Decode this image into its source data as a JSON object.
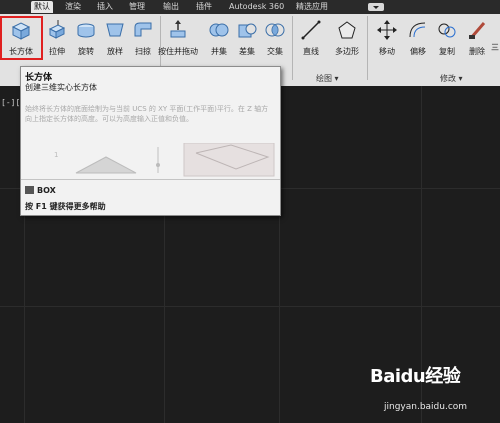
{
  "tabs": [
    {
      "label": "默认",
      "active": true
    },
    {
      "label": "渲染"
    },
    {
      "label": "插入"
    },
    {
      "label": "管理"
    },
    {
      "label": "输出"
    },
    {
      "label": "插件"
    },
    {
      "label": "Autodesk 360"
    },
    {
      "label": "精选应用"
    }
  ],
  "ribbon": {
    "modeling": {
      "box": "长方体",
      "extrude": "拉伸",
      "revolve": "旋转",
      "loft": "放样",
      "sweep": "扫掠",
      "presspull": "按住并拖动",
      "union": "并集",
      "subtract": "差集",
      "intersect": "交集"
    },
    "draw": {
      "line": "直线",
      "polygon": "多边形",
      "group_label": "绘图 ▾"
    },
    "modify": {
      "move": "移动",
      "offset": "偏移",
      "copy": "复制",
      "erase": "删除",
      "extra": "三",
      "group_label": "修改 ▾"
    }
  },
  "viewport": {
    "label": "[-][俯"
  },
  "tooltip": {
    "title": "长方体",
    "subtitle": "创建三维实心长方体",
    "description": "始终将长方体的底面绘制为与当前 UCS 的 XY 平面(工作平面)平行。在 Z 轴方向上指定长方体的高度。可以为高度输入正值和负值。",
    "command": "BOX",
    "help": "按 F1 键获得更多帮助"
  },
  "watermark": {
    "logo": "Baidu经验",
    "url": "jingyan.baidu.com"
  }
}
